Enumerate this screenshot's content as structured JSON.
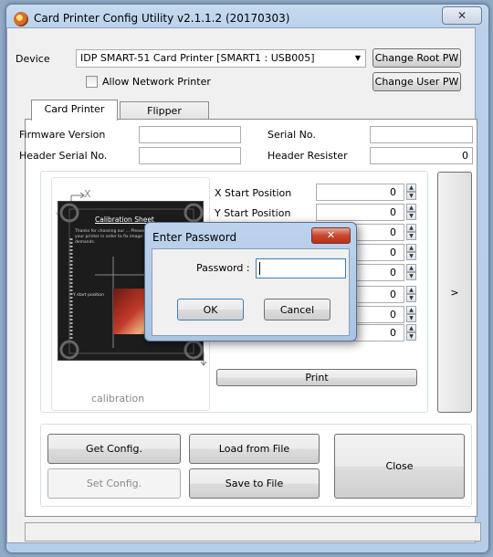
{
  "window": {
    "title": "Card Printer Config Utility v2.1.1.2 (20170303)",
    "close_glyph": "✕",
    "icon": "card-printer-app-icon"
  },
  "device": {
    "label": "Device",
    "selected": "IDP SMART-51 Card Printer  [SMART1 : USB005]",
    "allow_network_label": "Allow Network Printer",
    "change_root_pw": "Change Root PW",
    "change_user_pw": "Change User PW"
  },
  "tabs": [
    {
      "label": "Card Printer",
      "active": true
    },
    {
      "label": "Flipper",
      "active": false
    }
  ],
  "info": {
    "firmware_label": "Firmware Version",
    "firmware_value": "",
    "serial_label": "Serial No.",
    "serial_value": "",
    "header_serial_label": "Header Serial No.",
    "header_serial_value": "",
    "header_resister_label": "Header Resister",
    "header_resister_value": "0"
  },
  "calibration": {
    "sheet_title": "Calibration Sheet",
    "sheet_text": "Thanks for choosing our ... Please, adjust your printer in order to fix image your demands.",
    "axis_x": "X",
    "axis_y": "Y",
    "y_start_tag": "Y start position",
    "caption": "calibration"
  },
  "positions": [
    {
      "label": "X Start Position",
      "value": "0"
    },
    {
      "label": "Y Start Position",
      "value": "0"
    },
    {
      "label": "",
      "value": "0"
    },
    {
      "label": "",
      "value": "0"
    },
    {
      "label": "",
      "value": "0"
    },
    {
      "label": "",
      "value": "0"
    },
    {
      "label": "",
      "value": "0"
    },
    {
      "label": "",
      "value": "0"
    }
  ],
  "print_label": "Print",
  "side_arrow": ">",
  "buttons": {
    "get_config": "Get Config.",
    "load_file": "Load from File",
    "close": "Close",
    "set_config": "Set Config.",
    "save_file": "Save to File"
  },
  "dialog": {
    "title": "Enter Password",
    "close_glyph": "✕",
    "password_label": "Password :",
    "password_value": "",
    "ok": "OK",
    "cancel": "Cancel"
  },
  "status_text": ""
}
